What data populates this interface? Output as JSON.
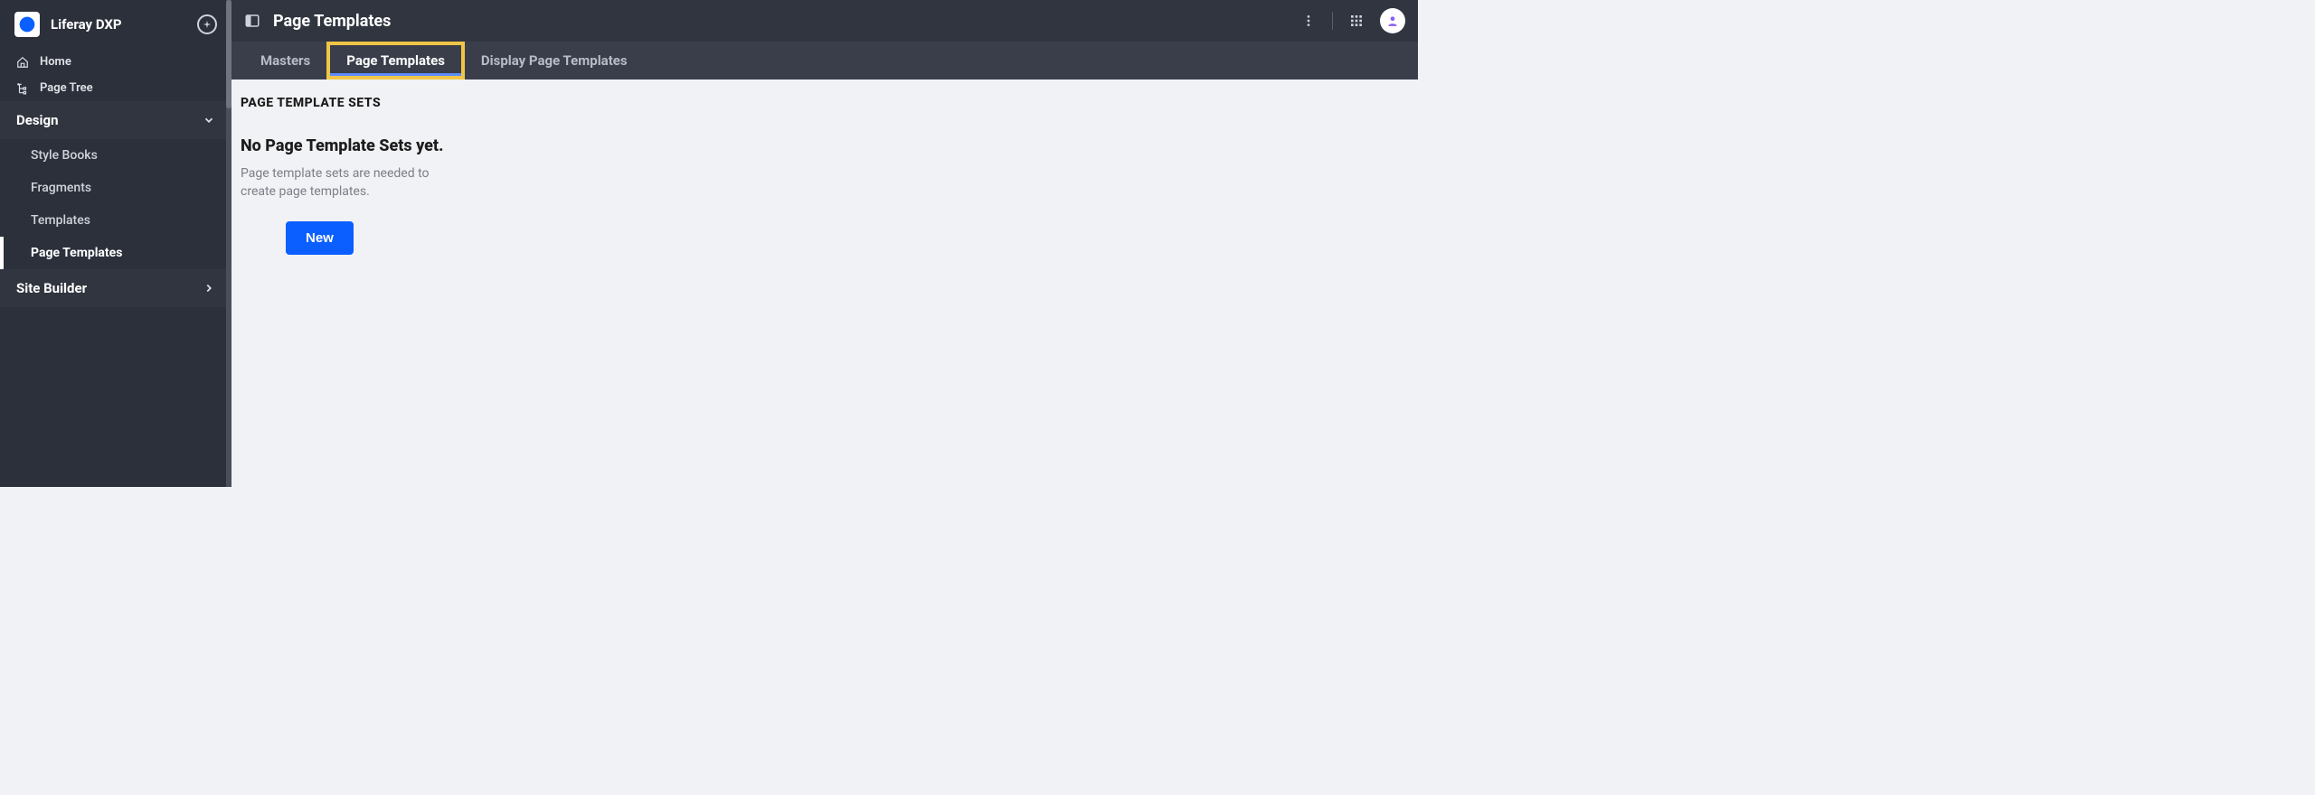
{
  "brand": {
    "title": "Liferay DXP"
  },
  "sidebar": {
    "nav": [
      {
        "label": "Home"
      },
      {
        "label": "Page Tree"
      }
    ],
    "sections": [
      {
        "label": "Design",
        "expanded": true,
        "items": [
          {
            "label": "Style Books",
            "active": false
          },
          {
            "label": "Fragments",
            "active": false
          },
          {
            "label": "Templates",
            "active": false
          },
          {
            "label": "Page Templates",
            "active": true
          }
        ]
      },
      {
        "label": "Site Builder",
        "expanded": false,
        "items": []
      }
    ]
  },
  "topbar": {
    "title": "Page Templates"
  },
  "tabs": [
    {
      "label": "Masters",
      "active": false
    },
    {
      "label": "Page Templates",
      "active": true
    },
    {
      "label": "Display Page Templates",
      "active": false
    }
  ],
  "content": {
    "section_title": "PAGE TEMPLATE SETS",
    "empty": {
      "title": "No Page Template Sets yet.",
      "description": "Page template sets are needed to create page templates.",
      "button": "New"
    }
  }
}
